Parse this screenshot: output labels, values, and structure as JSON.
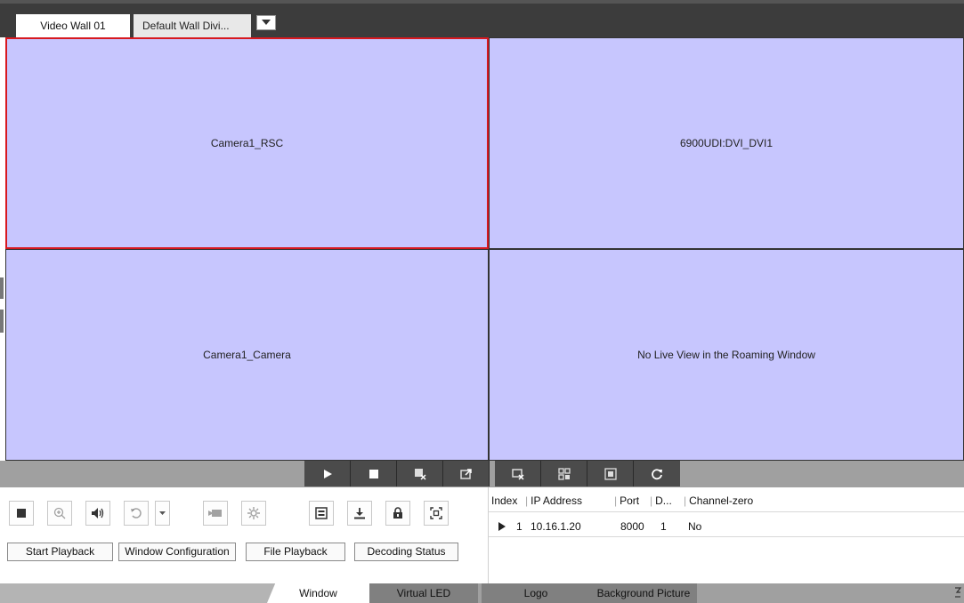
{
  "tabs": {
    "active_label": "Video Wall 01",
    "inactive_label": "Default Wall Divi..."
  },
  "windows": {
    "w1": "Camera1_RSC",
    "w2": "6900UDI:DVI_DVI1",
    "w3": "Camera1_Camera",
    "w4": "No Live View in the Roaming Window"
  },
  "playback_toolbar": {
    "icons": [
      "play-icon",
      "stop-icon",
      "close-window-icon",
      "export-window-icon",
      "close-all-icon",
      "window-split-icon",
      "fullscreen-window-icon",
      "refresh-icon"
    ]
  },
  "controls": {
    "icons": [
      "stop-icon",
      "zoom-icon",
      "audio-icon",
      "rewind-icon",
      "dropdown-icon",
      "record-icon",
      "settings-icon",
      "decode-icon",
      "download-icon",
      "lock-icon",
      "fit-window-icon"
    ],
    "start_playback": "Start Playback",
    "window_configuration": "Window Configuration",
    "file_playback": "File Playback",
    "decoding_status": "Decoding Status"
  },
  "device_table": {
    "columns": [
      "Index",
      "IP Address",
      "Port",
      "D...",
      "Channel-zero"
    ],
    "rows": [
      {
        "index": "1",
        "ip": "10.16.1.20",
        "port": "8000",
        "d": "1",
        "channel_zero": "No"
      }
    ]
  },
  "bottom_tabs": {
    "window": "Window",
    "virtual_led": "Virtual LED",
    "logo": "Logo",
    "background_picture": "Background Picture"
  },
  "colors": {
    "pane_fill": "#c7c6fe",
    "selected_border": "#d71920",
    "toolbar_dark": "#4b4b4b"
  }
}
